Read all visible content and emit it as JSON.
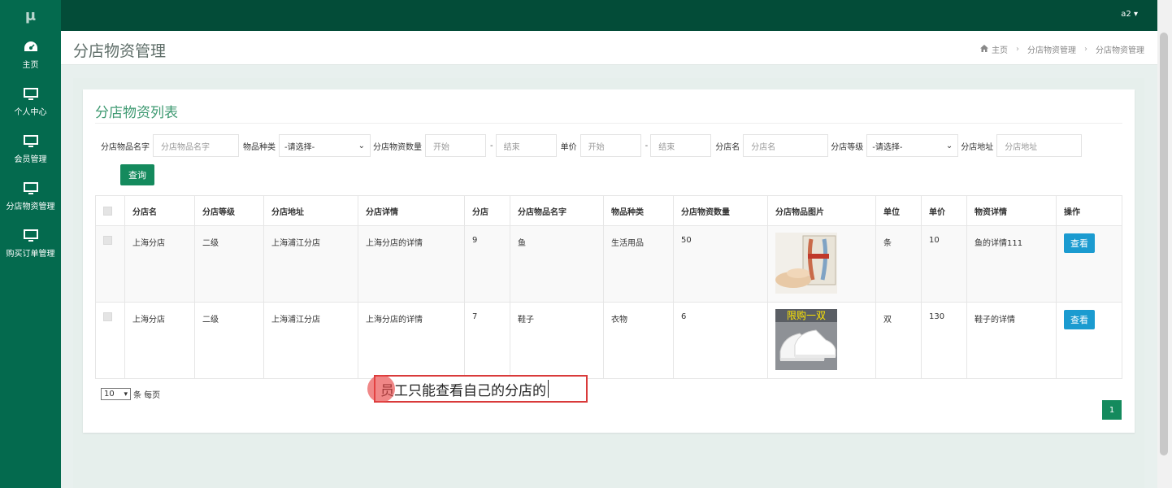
{
  "app": {
    "logo": "μ",
    "user": "a2 ▾"
  },
  "sidebar": {
    "items": [
      {
        "label": "主页",
        "icon": "dashboard-icon"
      },
      {
        "label": "个人中心",
        "icon": "monitor-icon"
      },
      {
        "label": "会员管理",
        "icon": "monitor-icon"
      },
      {
        "label": "分店物资管理",
        "icon": "monitor-icon"
      },
      {
        "label": "购买订单管理",
        "icon": "monitor-icon"
      }
    ]
  },
  "header": {
    "title": "分店物资管理",
    "breadcrumb": {
      "home": "主页",
      "level1": "分店物资管理",
      "level2": "分店物资管理",
      "separator": "›"
    }
  },
  "card": {
    "title": "分店物资列表"
  },
  "filters": {
    "item_name": {
      "label": "分店物品名字",
      "placeholder": "分店物品名字"
    },
    "category": {
      "label": "物品种类",
      "selected": "-请选择-"
    },
    "quantity": {
      "label": "分店物资数量",
      "from": "开始",
      "to": "结束"
    },
    "price": {
      "label": "单价",
      "from": "开始",
      "to": "结束"
    },
    "branch": {
      "label": "分店名",
      "placeholder": "分店名"
    },
    "level": {
      "label": "分店等级",
      "selected": "-请选择-"
    },
    "address": {
      "label": "分店地址",
      "placeholder": "分店地址"
    },
    "dash": "-",
    "query_label": "查询"
  },
  "table": {
    "headers": [
      "分店名",
      "分店等级",
      "分店地址",
      "分店详情",
      "分店",
      "分店物品名字",
      "物品种类",
      "分店物资数量",
      "分店物品图片",
      "单位",
      "单价",
      "物资详情",
      "操作"
    ],
    "rows": [
      {
        "branch": "上海分店",
        "level": "二级",
        "address": "上海浦江分店",
        "detail": "上海分店的详情",
        "store": "9",
        "item": "鱼",
        "category": "生活用品",
        "quantity": "50",
        "image": "fish-image",
        "unit": "条",
        "price": "10",
        "item_detail": "鱼的详情111",
        "action": "查看"
      },
      {
        "branch": "上海分店",
        "level": "二级",
        "address": "上海浦江分店",
        "detail": "上海分店的详情",
        "store": "7",
        "item": "鞋子",
        "category": "衣物",
        "quantity": "6",
        "image": "shoe-image",
        "image_text": "限购一双",
        "unit": "双",
        "price": "130",
        "item_detail": "鞋子的详情",
        "action": "查看"
      }
    ]
  },
  "pagination": {
    "page_size": "10",
    "per_page_label": "条 每页",
    "current_page": "1"
  },
  "annotation": {
    "text": "员工只能查看自己的分店的"
  },
  "colors": {
    "sidebar": "#046a4e",
    "topbar": "#034c38",
    "primary": "#148a5d",
    "view_button": "#1b9bd0",
    "annotation_border": "#d93a3a"
  }
}
